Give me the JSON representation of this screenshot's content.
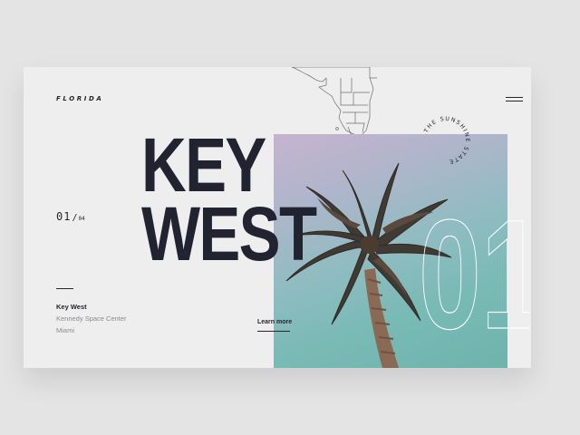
{
  "header": {
    "brand": "FLORIDA",
    "menu_icon": "hamburger-menu-icon"
  },
  "hero": {
    "title_line1": "KEY",
    "title_line2": "WEST",
    "slide_outline_number": "01"
  },
  "slide": {
    "current": "01",
    "separator": "/",
    "total": "04"
  },
  "places": [
    "Key West",
    "Kennedy Space Center",
    "Miami"
  ],
  "cta": {
    "label": "Learn more"
  },
  "badge": {
    "text": "THE SUNSHINE STATE"
  },
  "icons": {
    "map": "florida-map-icon",
    "menu": "hamburger-menu-icon",
    "badge": "circular-text-badge"
  },
  "colors": {
    "ink": "#222330",
    "card": "#eeeeef",
    "muted": "#8b8b90",
    "sky_top": "#c6b3cf",
    "sky_bottom": "#6fb3ad"
  }
}
